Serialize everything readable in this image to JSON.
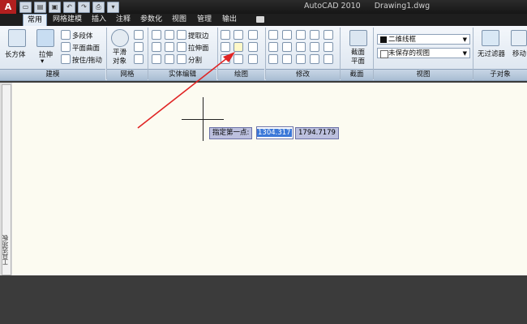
{
  "title_bar": {
    "app_name": "AutoCAD 2010",
    "file_name": "Drawing1.dwg",
    "app_logo": "A"
  },
  "tabs": [
    {
      "label": "常用"
    },
    {
      "label": "网格建模"
    },
    {
      "label": "插入"
    },
    {
      "label": "注释"
    },
    {
      "label": "参数化"
    },
    {
      "label": "视图"
    },
    {
      "label": "管理"
    },
    {
      "label": "输出"
    }
  ],
  "ribbon": {
    "modeling": {
      "box_label": "长方体",
      "extrude_label": "拉伸",
      "polysolid_label": "多段体",
      "planar_surface_label": "平面曲面",
      "presspull_label": "按住/拖动",
      "panel_title": "建模"
    },
    "mesh": {
      "smooth_label": "平滑\n对象",
      "panel_title": "网格"
    },
    "solid_editing": {
      "extract_edges_label": "提取边",
      "extrude_faces_label": "拉伸面",
      "separate_label": "分割",
      "panel_title": "实体编辑"
    },
    "draw": {
      "panel_title": "绘图"
    },
    "modify": {
      "panel_title": "修改"
    },
    "section": {
      "section_plane_label": "截面\n平面",
      "panel_title": "截面"
    },
    "view": {
      "visual_style": "二维线框",
      "named_view": "未保存的视图",
      "panel_title": "视图"
    },
    "subobject": {
      "no_filter_label": "无过滤器",
      "move_label": "移动",
      "panel_title": "子对象"
    }
  },
  "canvas": {
    "prompt": "指定第一点:",
    "coord_x": "1304.317",
    "coord_y": "1794.7179",
    "background": "#fcfbf1",
    "annotation_color": "#e02424"
  },
  "palette": {
    "vertical_label": "工具选项板"
  }
}
